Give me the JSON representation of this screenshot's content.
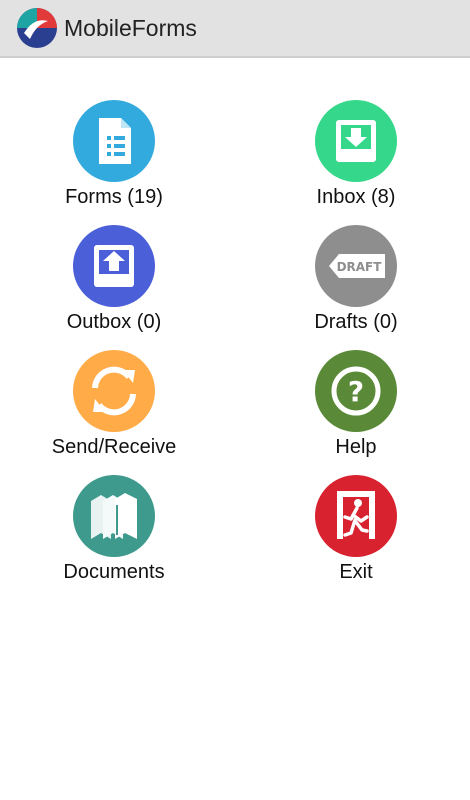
{
  "app": {
    "title": "MobileForms"
  },
  "tiles": [
    {
      "label": "Forms (19)",
      "icon": "forms-icon",
      "color": "#33aadd"
    },
    {
      "label": "Inbox (8)",
      "icon": "inbox-icon",
      "color": "#35d88a"
    },
    {
      "label": "Outbox (0)",
      "icon": "outbox-icon",
      "color": "#4a5fd8"
    },
    {
      "label": "Drafts (0)",
      "icon": "drafts-icon",
      "color": "#8e8e8e",
      "badge": "DRAFT"
    },
    {
      "label": "Send/Receive",
      "icon": "sync-icon",
      "color": "#ffab48"
    },
    {
      "label": "Help",
      "icon": "help-icon",
      "color": "#5a8a38"
    },
    {
      "label": "Documents",
      "icon": "documents-icon",
      "color": "#3e9a8c"
    },
    {
      "label": "Exit",
      "icon": "exit-icon",
      "color": "#d82230"
    }
  ]
}
